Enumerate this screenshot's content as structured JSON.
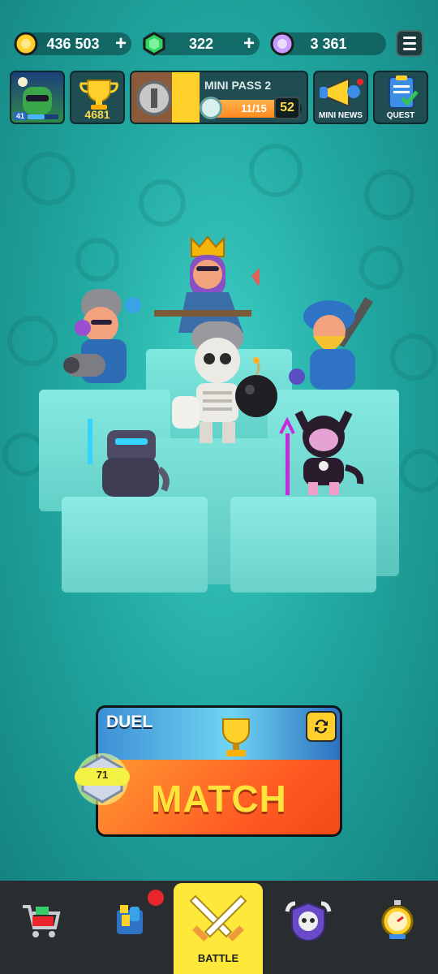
{
  "currencies": {
    "coins": "436 503",
    "gems": "322",
    "star_points": "3 361",
    "plus_symbol": "+"
  },
  "profile": {
    "level": "41"
  },
  "trophies": {
    "count": "4681"
  },
  "mini_pass": {
    "title": "MINI PASS 2",
    "progress_text": "11/15",
    "progress_fraction": 0.73,
    "level": "52"
  },
  "tiles": {
    "mini_news_label": "MINI NEWS",
    "quest_label": "QUEST"
  },
  "match": {
    "mode": "DUEL",
    "button_label": "MATCH",
    "rank": "71"
  },
  "nav": {
    "battle_label": "BATTLE"
  },
  "colors": {
    "accent_yellow": "#fee83a",
    "match_orange": "#ff5a22",
    "match_text": "#ffe23a",
    "arena_teal": "#22aaa3",
    "nav_bg": "#2a2d30"
  }
}
